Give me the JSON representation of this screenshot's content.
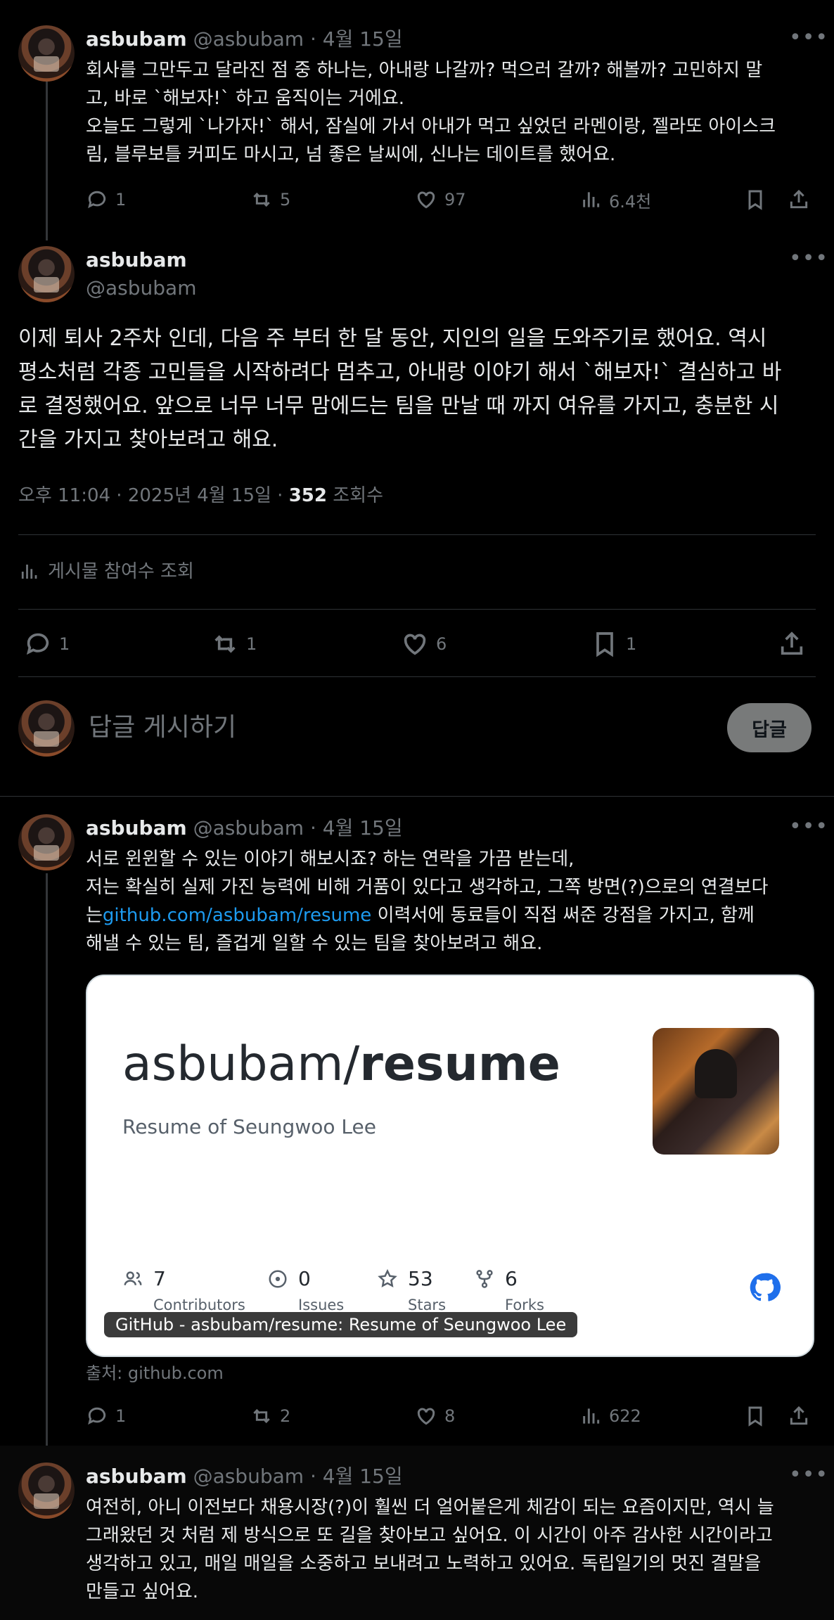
{
  "tweet1": {
    "name": "asbubam",
    "handle": "@asbubam",
    "date": "· 4월 15일",
    "lines": [
      "회사를 그만두고 달라진 점 중 하나는, 아내랑 나갈까? 먹으러 갈까? 해볼까? 고민하지 말",
      "고, 바로 `해보자!` 하고 움직이는 거에요.",
      "오늘도 그렇게 `나가자!` 해서, 잠실에 가서 아내가 먹고 싶었던 라멘이랑, 젤라또 아이스크",
      "림, 블루보틀 커피도 마시고, 넘 좋은 날씨에, 신나는 데이트를 했어요."
    ],
    "replies": "1",
    "retweets": "5",
    "likes": "97",
    "views": "6.4천"
  },
  "main_tweet": {
    "name": "asbubam",
    "handle": "@asbubam",
    "lines": [
      "이제 퇴사 2주차 인데, 다음 주 부터 한 달 동안, 지인의 일을 도와주기로 했어요. 역시",
      "평소처럼 각종 고민들을 시작하려다 멈추고, 아내랑 이야기 해서 `해보자!` 결심하고 바",
      "로 결정했어요. 앞으로 너무 너무 맘에드는 팀을 만날 때 까지 여유를 가지고, 충분한 시",
      "간을 가지고 찾아보려고 해요."
    ],
    "timestamp": "오후 11:04 · 2025년 4월 15일 · ",
    "view_count": "352",
    "view_label": " 조회수",
    "engagement_label": "게시물 참여수 조회",
    "replies": "1",
    "retweets": "1",
    "likes": "6",
    "bookmarks": "1"
  },
  "reply_box": {
    "placeholder": "답글 게시하기",
    "button_label": "답글"
  },
  "tweet3": {
    "name": "asbubam",
    "handle": "@asbubam",
    "date": "· 4월 15일",
    "line1": "서로 윈윈할 수 있는 이야기 해보시죠? 하는 연락을 가끔 받는데,",
    "line2": "저는 확실히 실제 가진 능력에 비해 거품이 있다고 생각하고, 그쪽 방면(?)으로의  연결보다",
    "line3_pre": "는",
    "link": "github.com/asbubam/resume",
    "line3_post": " 이력서에 동료들이 직접 써준 강점을 가지고, 함께",
    "line4": "해낼 수 있는 팀, 즐겁게 일할 수 있는 팀을 찾아보려고 해요.",
    "card": {
      "title_owner": "asbubam/",
      "title_repo": "resume",
      "description": "Resume of Seungwoo Lee",
      "contributors": "7",
      "contributors_label": "Contributors",
      "issues": "0",
      "issues_label": "Issues",
      "stars": "53",
      "stars_label": "Stars",
      "forks": "6",
      "forks_label": "Forks",
      "caption": "GitHub - asbubam/resume: Resume of Seungwoo Lee"
    },
    "source": "출처: github.com",
    "replies": "1",
    "retweets": "2",
    "likes": "8",
    "views": "622"
  },
  "tweet4": {
    "name": "asbubam",
    "handle": "@asbubam",
    "date": "· 4월 15일",
    "lines": [
      "여전히, 아니 이전보다 채용시장(?)이 훨씬 더 얼어붙은게 체감이 되는 요즘이지만, 역시 늘",
      "그래왔던 것 처럼 제 방식으로 또 길을 찾아보고 싶어요. 이 시간이 아주 감사한 시간이라고",
      "생각하고 있고, 매일 매일을 소중하고 보내려고 노력하고 있어요. 독립일기의 멋진 결말을",
      "만들고 싶어요."
    ]
  }
}
